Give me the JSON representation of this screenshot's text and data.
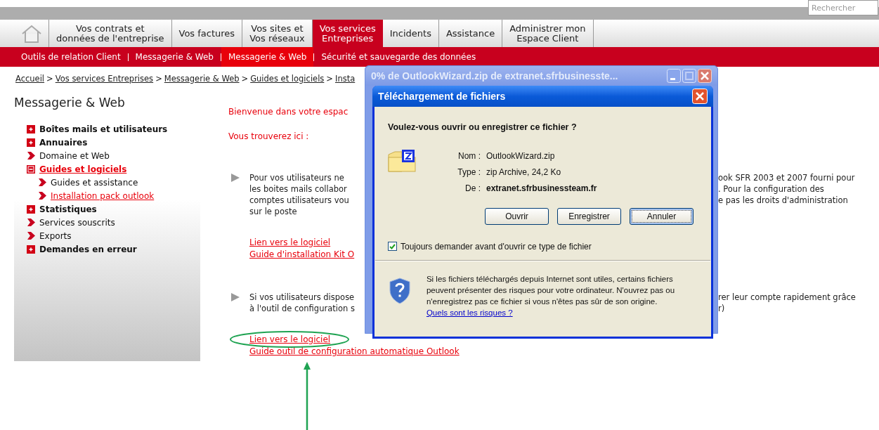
{
  "search": {
    "placeholder": "Rechercher"
  },
  "nav": {
    "tabs": [
      {
        "label": "Vos contrats et\ndonnées de l'entreprise",
        "selected": false
      },
      {
        "label": "Vos factures",
        "selected": false
      },
      {
        "label": "Vos sites et\nVos réseaux",
        "selected": false
      },
      {
        "label": "Vos services\nEntreprises",
        "selected": true
      },
      {
        "label": "Incidents",
        "selected": false
      },
      {
        "label": "Assistance",
        "selected": false
      },
      {
        "label": "Administrer mon\nEspace Client",
        "selected": false
      }
    ]
  },
  "subnav": [
    {
      "label": "Outils de relation Client",
      "selected": false
    },
    {
      "label": "Messagerie & Web",
      "selected": false
    },
    {
      "label": "Messagerie & Web",
      "selected": true
    },
    {
      "label": "Sécurité et sauvegarde des données",
      "selected": false
    }
  ],
  "breadcrumb": {
    "separator": ">",
    "items": [
      "Accueil",
      "Vos services Entreprises",
      "Messagerie & Web",
      "Guides et logiciels",
      "Insta"
    ]
  },
  "sidebar": {
    "title": "Messagerie & Web",
    "items": [
      {
        "label": "Boîtes mails et utilisateurs",
        "kind": "folder",
        "expanded": false,
        "selected": false
      },
      {
        "label": "Annuaires",
        "kind": "folder",
        "expanded": false,
        "selected": false
      },
      {
        "label": "Domaine et Web",
        "kind": "leaf",
        "selected": false
      },
      {
        "label": "Guides et logiciels",
        "kind": "folder",
        "expanded": true,
        "selected": true,
        "children": [
          {
            "label": "Guides et assistance",
            "kind": "leaf",
            "selected": false
          },
          {
            "label": "Installation pack outlook",
            "kind": "leaf",
            "selected": true
          }
        ]
      },
      {
        "label": "Statistiques",
        "kind": "folder",
        "expanded": false,
        "selected": false
      },
      {
        "label": "Services souscrits",
        "kind": "leaf",
        "selected": false
      },
      {
        "label": "Exports",
        "kind": "leaf",
        "selected": false
      },
      {
        "label": "Demandes en erreur",
        "kind": "folder",
        "expanded": false,
        "selected": false
      }
    ]
  },
  "content": {
    "greeting": "Bienvenue dans votre espac",
    "intro": "Vous trouverez ici :",
    "sections": [
      {
        "lines": [
          {
            "left": "Pour vos utilisateurs ne",
            "right": "ook SFR 2003 et 2007 fourni pour"
          },
          {
            "left": "les boites mails collabor",
            "right": ". Pour la configuration des"
          },
          {
            "left": "comptes utilisateurs vou",
            "right": "e pas les droits d'administration"
          },
          {
            "left": "sur le poste"
          }
        ],
        "links": [
          "Lien vers le logiciel",
          "Guide d'installation Kit O"
        ]
      },
      {
        "lines": [
          {
            "left": "Si vos utilisateurs dispose",
            "right": "rer leur compte rapidement grâce"
          },
          {
            "left": "à l'outil de configuration s",
            "right": "r)"
          }
        ],
        "links": [
          "Lien vers le logiciel",
          "Guide outil de configuration automatique Outlook"
        ]
      }
    ]
  },
  "progress_window": {
    "title": "0% de OutlookWizard.zip de extranet.sfrbusinesste..."
  },
  "dialog": {
    "title": "Téléchargement de fichiers",
    "question": "Voulez-vous ouvrir ou enregistrer ce fichier ?",
    "fields": [
      {
        "label": "Nom :",
        "value": "OutlookWizard.zip",
        "bold": false
      },
      {
        "label": "Type :",
        "value": "zip Archive, 24,2 Ko",
        "bold": false
      },
      {
        "label": "De :",
        "value": "extranet.sfrbusinessteam.fr",
        "bold": true
      }
    ],
    "buttons": [
      {
        "label": "Ouvrir",
        "focused": false
      },
      {
        "label": "Enregistrer",
        "focused": false
      },
      {
        "label": "Annuler",
        "focused": true
      }
    ],
    "checkbox": {
      "label": "Toujours demander avant d'ouvrir ce type de fichier",
      "checked": true
    },
    "warning": "Si les fichiers téléchargés depuis Internet sont utiles, certains fichiers peuvent présenter des risques pour votre ordinateur. N'ouvrez pas ou n'enregistrez pas ce fichier si vous n'êtes pas sûr de son origine.",
    "warning_link": "Quels sont les risques ?"
  }
}
